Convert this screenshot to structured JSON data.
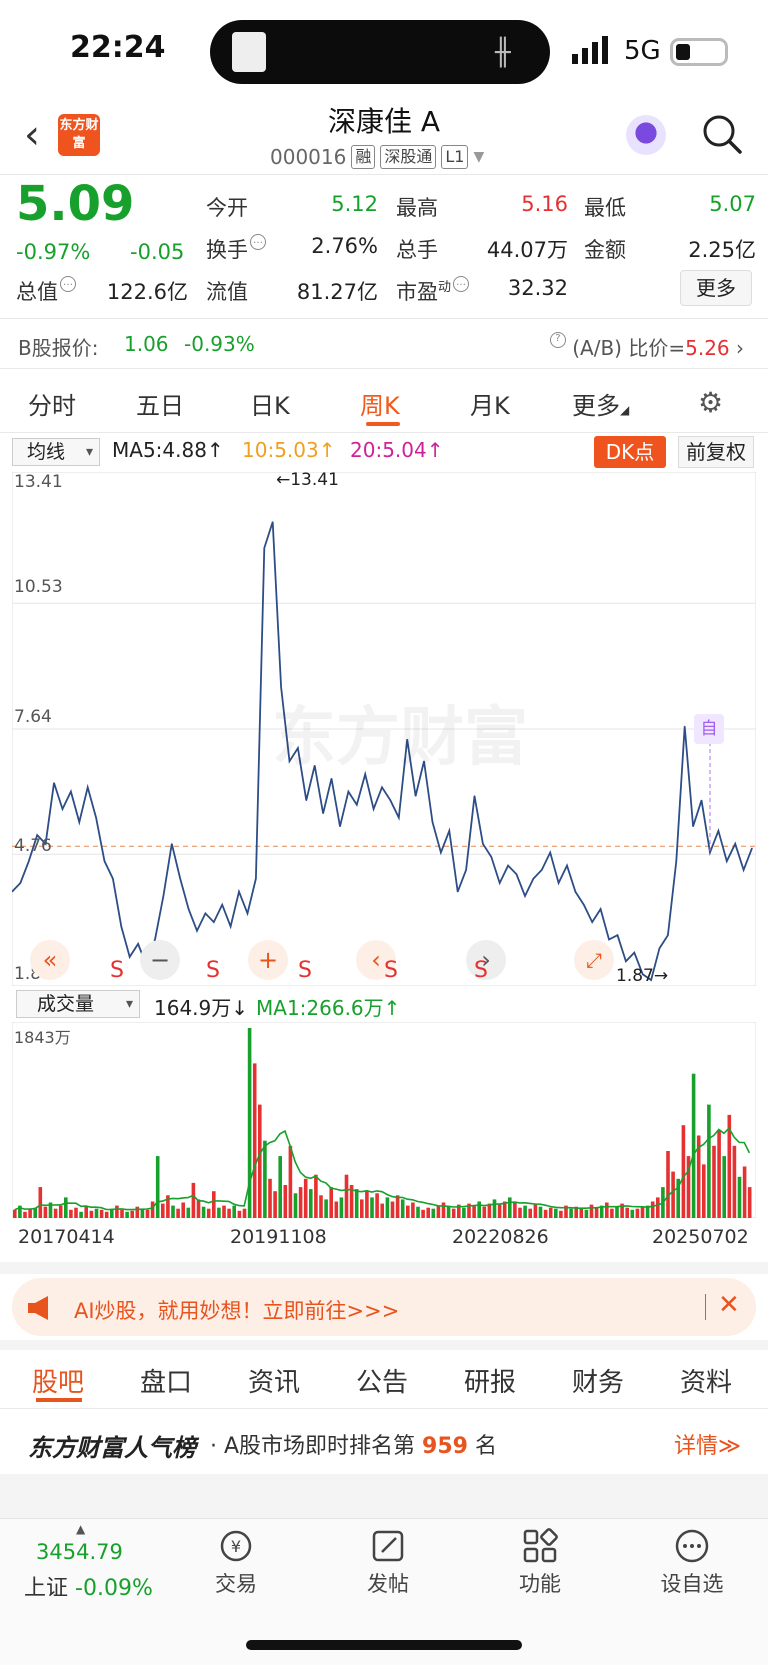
{
  "status_bar": {
    "time": "22:24",
    "network": "5G",
    "colors": {
      "text": "#111111"
    }
  },
  "header": {
    "logo_text": "东方财富",
    "title": "深康佳 A",
    "code": "000016",
    "tags": [
      "融",
      "深股通",
      "L1"
    ]
  },
  "quote": {
    "price": "5.09",
    "change_pct": "-0.97%",
    "change": "-0.05",
    "fields": {
      "open_label": "今开",
      "open": "5.12",
      "high_label": "最高",
      "high": "5.16",
      "low_label": "最低",
      "low": "5.07",
      "turnover_label": "换手",
      "turnover": "2.76%",
      "vol_label": "总手",
      "vol": "44.07万",
      "amount_label": "金额",
      "amount": "2.25亿",
      "mcap_label": "总值",
      "mcap": "122.6亿",
      "float_label": "流值",
      "float": "81.27亿",
      "pe_label": "市盈",
      "pe_super": "动",
      "pe": "32.32"
    },
    "more_label": "更多"
  },
  "bshare": {
    "label": "B股报价:",
    "price": "1.06",
    "pct": "-0.93%",
    "ratio_label": "(A/B) 比价=",
    "ratio": "5.26"
  },
  "tabs": [
    "分时",
    "五日",
    "日K",
    "周K",
    "月K",
    "更多"
  ],
  "active_tab": "周K",
  "chart_header": {
    "indicator": "均线",
    "ma5": "MA5:4.88↑",
    "ma10": "10:5.03↑",
    "ma20": "20:5.04↑",
    "dk_label": "DK点",
    "adjust_label": "前复权"
  },
  "chart_labels": {
    "y_max": "13.41",
    "y_mid1": "10.53",
    "y_mid2": "7.64",
    "y_ref": "4.76",
    "y_min": "1.87",
    "peak_label": "←13.41",
    "low_label": "1.87→",
    "marker": "自",
    "watermark": "东方财富",
    "s_mark": "S"
  },
  "chart_data": [
    {
      "type": "line",
      "title": "",
      "ylim": [
        1.87,
        13.41
      ],
      "ref_line": 4.76,
      "x_labels": [
        "20170414",
        "20191108",
        "20220826",
        "20250702"
      ],
      "series": [
        {
          "values": [
            3.9,
            4.1,
            4.6,
            5.2,
            5.0,
            6.4,
            5.8,
            6.2,
            5.5,
            6.3,
            5.6,
            4.6,
            4.2,
            3.1,
            2.4,
            2.7,
            2.2,
            2.8,
            3.8,
            5.0,
            4.2,
            3.5,
            3.0,
            3.4,
            3.2,
            3.6,
            3.1,
            3.9,
            3.4,
            4.2,
            11.8,
            12.4,
            8.6,
            6.9,
            7.2,
            6.0,
            6.8,
            5.7,
            6.5,
            5.4,
            6.2,
            5.9,
            6.6,
            5.8,
            6.3,
            6.0,
            5.6,
            7.4,
            6.1,
            6.9,
            5.5,
            4.8,
            5.3,
            3.9,
            4.4,
            6.1,
            5.0,
            4.7,
            4.1,
            4.5,
            4.3,
            3.8,
            4.2,
            4.4,
            4.8,
            4.1,
            4.5,
            3.9,
            3.6,
            3.2,
            3.5,
            2.8,
            2.9,
            2.3,
            2.5,
            2.0,
            1.87,
            2.6,
            2.9,
            4.6,
            7.7,
            5.4,
            6.0,
            4.8,
            5.3,
            4.6,
            5.0,
            4.4,
            4.9
          ]
        }
      ]
    },
    {
      "type": "bar",
      "title": "",
      "ylim": [
        0,
        1843
      ],
      "label_max": "1843万",
      "series": [
        {
          "name": "成交量",
          "values": [
            80,
            120,
            60,
            90,
            100,
            300,
            110,
            150,
            90,
            120,
            200,
            80,
            100,
            60,
            120,
            70,
            90,
            80,
            60,
            90,
            120,
            80,
            60,
            70,
            110,
            90,
            80,
            160,
            600,
            140,
            220,
            120,
            90,
            150,
            100,
            340,
            180,
            110,
            90,
            260,
            100,
            120,
            90,
            120,
            70,
            90,
            1843,
            1500,
            1100,
            750,
            380,
            260,
            600,
            320,
            700,
            240,
            300,
            380,
            280,
            420,
            220,
            180,
            300,
            160,
            200,
            420,
            320,
            280,
            180,
            260,
            200,
            240,
            140,
            200,
            160,
            220,
            180,
            120,
            150,
            110,
            80,
            100,
            90,
            120,
            150,
            110,
            90,
            130,
            100,
            140,
            120,
            160,
            110,
            140,
            180,
            130,
            160,
            200,
            150,
            100,
            120,
            90,
            140,
            110,
            80,
            100,
            90,
            70,
            120,
            90,
            110,
            100,
            80,
            130,
            100,
            120,
            150,
            90,
            110,
            140,
            100,
            80,
            90,
            110,
            120,
            160,
            200,
            300,
            650,
            450,
            380,
            900,
            600,
            1400,
            800,
            520,
            1100,
            700,
            850,
            600,
            1000,
            700,
            400,
            500,
            300
          ]
        }
      ]
    }
  ],
  "volume_header": {
    "label": "成交量",
    "vol": "164.9万↓",
    "ma1": "MA1:266.6万↑"
  },
  "ad": {
    "text": "AI炒股，就用妙想！立即前往>>>",
    "close": "✕"
  },
  "bottom_tabs": [
    "股吧",
    "盘口",
    "资讯",
    "公告",
    "研报",
    "财务",
    "资料"
  ],
  "rank": {
    "brand": "东方财富人气榜",
    "prefix": "· A股市场即时排名第",
    "num": "959",
    "suffix": "名",
    "detail": "详情≫"
  },
  "bottom_nav": {
    "index_value": "3454.79",
    "index_label": "上证",
    "index_pct": "-0.09%",
    "items": [
      "交易",
      "发帖",
      "功能",
      "设自选"
    ]
  },
  "colors": {
    "accent": "#f05a1a",
    "up": "#e53131",
    "down": "#17a02b",
    "line": "#2d4d86"
  }
}
